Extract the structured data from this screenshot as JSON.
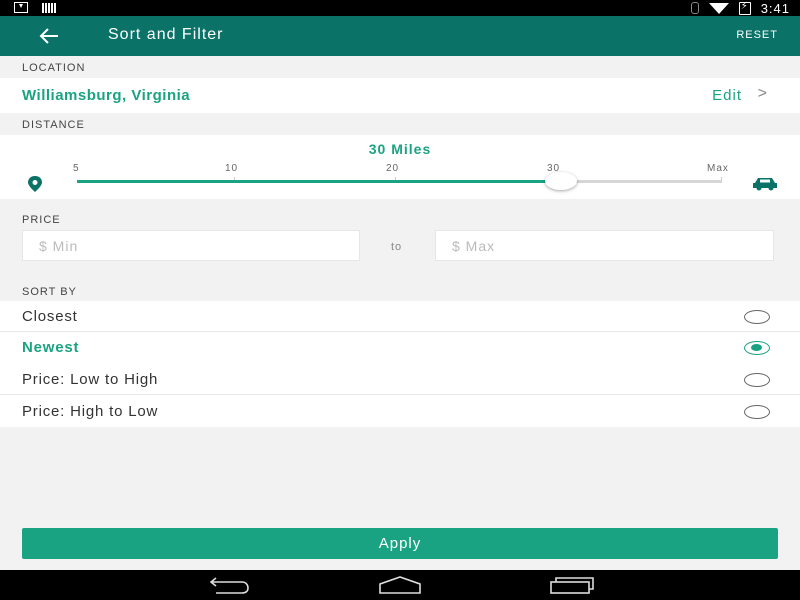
{
  "status_bar": {
    "time": "3:41",
    "icons": [
      "download-icon",
      "signal-bars-icon",
      "bluetooth-icon",
      "wifi-icon",
      "battery-charging-icon"
    ]
  },
  "app_bar": {
    "title": "Sort and Filter",
    "reset_label": "RESET",
    "back_icon": "arrow-left-icon"
  },
  "location": {
    "section_label": "LOCATION",
    "value": "Williamsburg, Virginia",
    "edit_label": "Edit",
    "chevron": ">"
  },
  "distance": {
    "section_label": "DISTANCE",
    "value_label": "30 Miles",
    "ticks": [
      "5",
      "10",
      "20",
      "30",
      "Max"
    ],
    "slider_level_fraction": 0.75,
    "left_icon": "map-pin-icon",
    "right_icon": "car-icon"
  },
  "price": {
    "section_label": "PRICE",
    "min_placeholder": "$  Min",
    "to_label": "to",
    "max_placeholder": "$  Max"
  },
  "sort": {
    "section_label": "SORT BY",
    "options": [
      {
        "label": "Closest",
        "selected": false
      },
      {
        "label": "Newest",
        "selected": true
      },
      {
        "label": "Price: Low to High",
        "selected": false
      },
      {
        "label": "Price: High to Low",
        "selected": false
      }
    ]
  },
  "apply_label": "Apply",
  "colors": {
    "app_bar": "#0a7267",
    "accent": "#1aa383",
    "background": "#f2f2f2"
  },
  "nav_bar": {
    "icons": [
      "back-nav-icon",
      "home-nav-icon",
      "recents-nav-icon"
    ]
  }
}
